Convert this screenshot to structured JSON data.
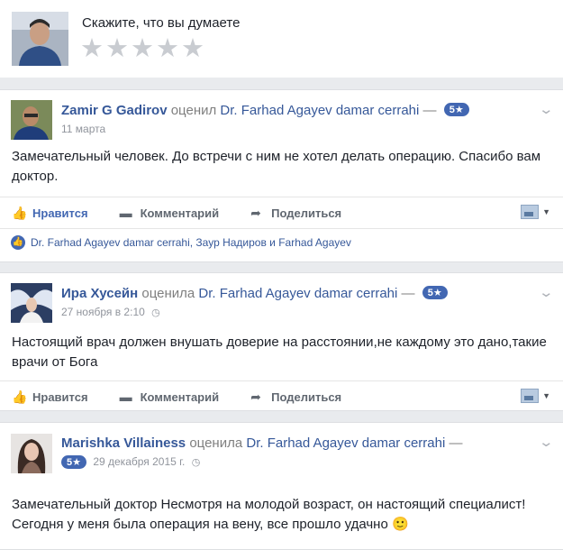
{
  "compose": {
    "prompt": "Скажите, что вы думаете",
    "star_count": 5
  },
  "reviews": [
    {
      "author": "Zamir G Gadirov",
      "action": "оценил",
      "page": "Dr. Farhad Agayev damar cerrahi",
      "dash": "—",
      "rating": "5★",
      "date": "11 марта",
      "text": "Замечательный человек. До встречи с ним не хотел делать операцию. Спасибо вам доктор.",
      "like_label": "Нравится",
      "comment_label": "Комментарий",
      "share_label": "Поделиться",
      "liked": true,
      "likes_text": "Dr. Farhad Agayev damar cerrahi, Заур Надиров и Farhad Agayev"
    },
    {
      "author": "Ира Хусейн",
      "action": "оценила",
      "page": "Dr. Farhad Agayev damar cerrahi",
      "dash": "—",
      "rating": "5★",
      "date": "27 ноября в 2:10",
      "text": "Настоящий врач должен внушать доверие на расстоянии,не каждому это дано,такие врачи от Бога",
      "like_label": "Нравится",
      "comment_label": "Комментарий",
      "share_label": "Поделиться",
      "liked": false
    },
    {
      "author": "Marishka Villainess",
      "action": "оценила",
      "page": "Dr. Farhad Agayev damar cerrahi",
      "dash": "—",
      "rating": "5★",
      "date": "29 декабря 2015 г.",
      "text": "Замечательный доктор Несмотря на молодой возраст, он настоящий специалист! Сегодня у меня была операция на вену, все прошло удачно 🙂"
    }
  ],
  "colors": {
    "link_blue": "#365899",
    "badge_blue": "#4267b2",
    "muted_gray": "#90949c",
    "background": "#e9ebee"
  },
  "icons": {
    "like": "thumbs-up-icon",
    "comment": "comment-icon",
    "share": "share-arrow-icon",
    "options": "chevron-down-icon",
    "privacy": "globe-icon"
  }
}
